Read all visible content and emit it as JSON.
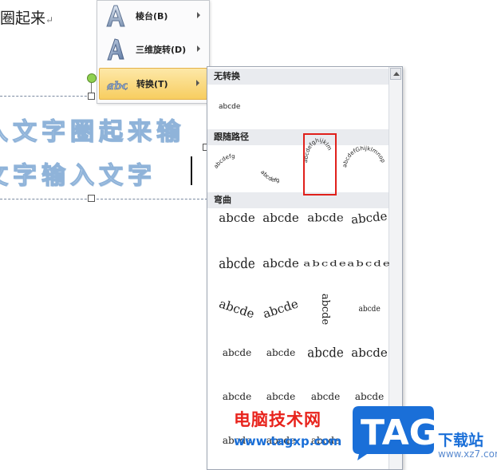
{
  "document": {
    "top_text": "圈起来",
    "para_mark": "↵",
    "wordart_line1": "入文字圈起来输",
    "wordart_line2": "文字输入文字"
  },
  "text_effects_menu": {
    "items": [
      {
        "label": "棱台(B)",
        "icon": "bevel-a-icon"
      },
      {
        "label": "三维旋转(D)",
        "icon": "3d-rotation-a-icon"
      },
      {
        "label": "转换(T)",
        "icon": "transform-abc-icon",
        "active": true
      }
    ]
  },
  "transform_gallery": {
    "sections": [
      {
        "title": "无转换",
        "items": [
          "abcde"
        ]
      },
      {
        "title": "跟随路径",
        "items": [
          "abcdefg",
          "abcdefg",
          "abcdefghijklm",
          "abcdefGhijklmnop"
        ]
      },
      {
        "title": "弯曲",
        "rows": [
          [
            "abcde",
            "abcde",
            "abcde",
            "abcde"
          ],
          [
            "abcde",
            "abcde",
            "abcde",
            "abcde"
          ],
          [
            "abcde",
            "abcde",
            "abcde",
            "abcde"
          ],
          [
            "abcde",
            "abcde",
            "abcde",
            "abcde"
          ],
          [
            "abcde",
            "abcde",
            "abcde",
            "abcde"
          ],
          [
            "abcde",
            "abcde",
            "abcde",
            "abcde"
          ]
        ]
      }
    ],
    "highlight_color": "#e0201b"
  },
  "watermark": {
    "cn_name": "电脑技术网",
    "url": "www.tagxp.com",
    "logo": "TAG",
    "download": "下载站",
    "site": "www.xz7.com"
  }
}
